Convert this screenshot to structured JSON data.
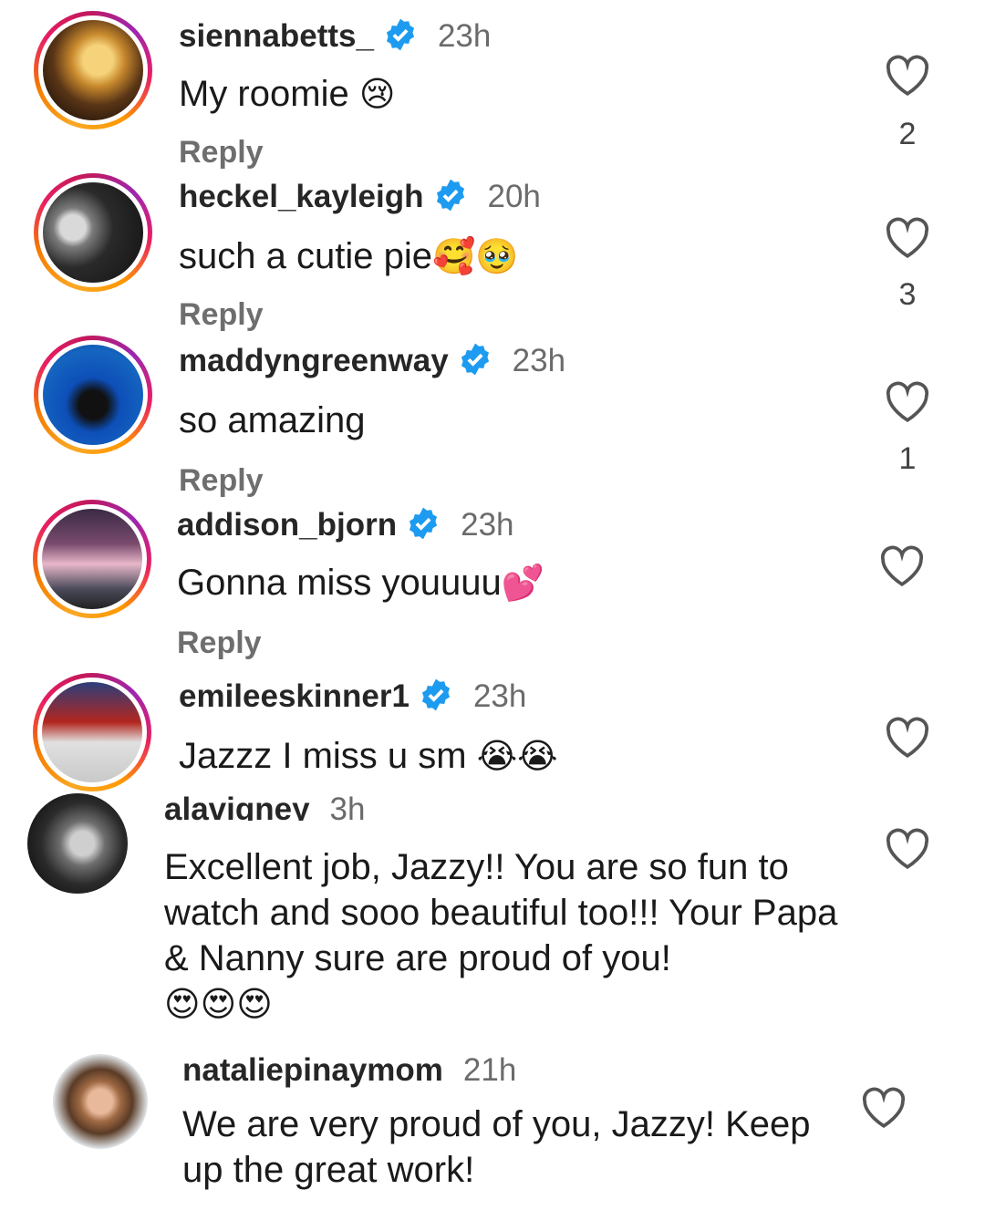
{
  "comments": [
    {
      "username": "siennabetts_",
      "time": "23h",
      "text": "My roomie",
      "emoji": "😢",
      "reply": "Reply",
      "likes": "2"
    },
    {
      "username": "heckel_kayleigh",
      "time": "20h",
      "text": "such a cutie pie",
      "emoji": "🥰🥹",
      "reply": "Reply",
      "likes": "3"
    },
    {
      "username": "maddyngreenway",
      "time": "23h",
      "text": "so amazing",
      "emoji": "",
      "reply": "Reply",
      "likes": "1"
    },
    {
      "username": "addison_bjorn",
      "time": "23h",
      "text": "Gonna miss youuuu",
      "emoji": "💕",
      "reply": "Reply",
      "likes": ""
    },
    {
      "username": "emileeskinner1",
      "time": "23h",
      "text": "Jazzz I miss u sm",
      "emoji": "😭😭",
      "reply": "",
      "likes": ""
    },
    {
      "username": "alavigney",
      "time": "3h",
      "text": "Excellent job, Jazzy!! You are so fun to watch and sooo beautiful too!!! Your Papa & Nanny sure are proud of you!",
      "emoji": "😍😍😍",
      "reply": "",
      "likes": ""
    },
    {
      "username": "nataliepinaymom",
      "time": "21h",
      "text": "We are very proud of you, Jazzy! Keep up the great work!",
      "emoji": "",
      "reply": "",
      "likes": ""
    }
  ],
  "icons": {
    "like": "heart-outline-icon",
    "verified": "verified-badge-icon"
  },
  "colors": {
    "verified": "#1d9bf0",
    "reply": "#6e6e6e",
    "time": "#6b6b6b"
  }
}
